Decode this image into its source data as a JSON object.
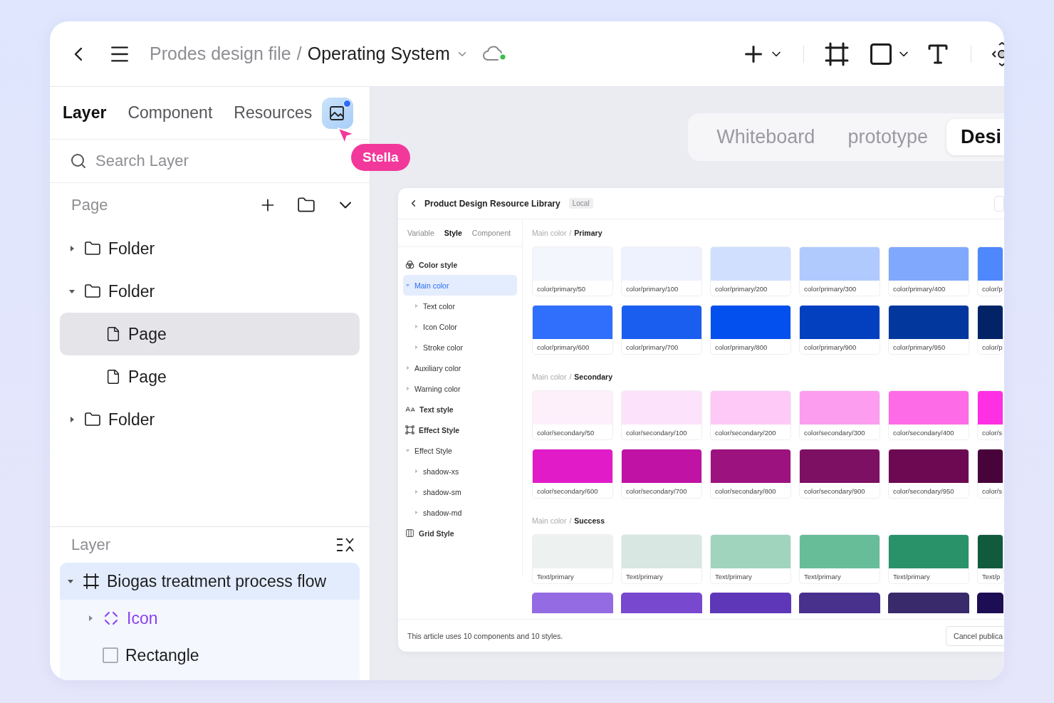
{
  "topbar": {
    "file": "Prodes design file",
    "separator": "/",
    "page": "Operating System"
  },
  "panel_tabs": [
    {
      "label": "Layer",
      "selected": true
    },
    {
      "label": "Component",
      "selected": false
    },
    {
      "label": "Resources",
      "selected": false
    }
  ],
  "resources_badge": {
    "unread": true
  },
  "cursor": {
    "name": "Stella"
  },
  "search": {
    "placeholder": "Search Layer"
  },
  "pages": {
    "title": "Page",
    "items": [
      {
        "kind": "folder",
        "label": "Folder",
        "expanded": false,
        "selected": false
      },
      {
        "kind": "folder",
        "label": "Folder",
        "expanded": true,
        "selected": false,
        "children": [
          {
            "kind": "page",
            "label": "Page",
            "selected": true
          },
          {
            "kind": "page",
            "label": "Page",
            "selected": false
          }
        ]
      },
      {
        "kind": "folder",
        "label": "Folder",
        "expanded": false,
        "selected": false
      }
    ]
  },
  "layers": {
    "title": "Layer",
    "items": [
      {
        "kind": "frame",
        "label": "Biogas treatment process flow",
        "expanded": true,
        "selected": true,
        "children": [
          {
            "kind": "component",
            "label": "Icon",
            "expanded": false,
            "selected": false
          },
          {
            "kind": "rectangle",
            "label": "Rectangle",
            "selected": false
          }
        ]
      }
    ]
  },
  "mode_tabs": [
    {
      "label": "Whiteboard",
      "selected": false
    },
    {
      "label": "prototype",
      "selected": false
    },
    {
      "label": "Desi",
      "selected": true
    }
  ],
  "library": {
    "title": "Product Design Resource Library",
    "tag": "Local",
    "tabs": [
      {
        "label": "Variable",
        "selected": false
      },
      {
        "label": "Style",
        "selected": true
      },
      {
        "label": "Component",
        "selected": false
      }
    ],
    "tree": [
      {
        "kind": "color",
        "label": "Color style",
        "children": [
          {
            "label": "Main color",
            "expanded": true,
            "selected": true,
            "children": [
              {
                "label": "Text color",
                "expanded": false,
                "selected": false
              },
              {
                "label": "Icon Color",
                "expanded": false,
                "selected": false
              },
              {
                "label": "Stroke color",
                "expanded": false,
                "selected": false
              }
            ]
          },
          {
            "label": "Auxiliary color",
            "expanded": false,
            "selected": false
          },
          {
            "label": "Warning color",
            "expanded": false,
            "selected": false
          }
        ]
      },
      {
        "kind": "text",
        "label": "Text style"
      },
      {
        "kind": "effect",
        "label": "Effect Style",
        "children": [
          {
            "label": "Effect Style",
            "expanded": true,
            "selected": false,
            "children": [
              {
                "label": "shadow-xs",
                "expanded": false,
                "selected": false
              },
              {
                "label": "shadow-sm",
                "expanded": false,
                "selected": false
              },
              {
                "label": "shadow-md",
                "expanded": false,
                "selected": false
              }
            ]
          }
        ]
      },
      {
        "kind": "grid",
        "label": "Grid Style"
      }
    ],
    "sections": [
      {
        "group": "Main color",
        "separator": "/",
        "name": "Primary",
        "rows": [
          [
            {
              "label": "color/primary/50",
              "color": "#f3f6fd"
            },
            {
              "label": "color/primary/100",
              "color": "#edf2fe"
            },
            {
              "label": "color/primary/200",
              "color": "#d0dffd"
            },
            {
              "label": "color/primary/300",
              "color": "#b0cafe"
            },
            {
              "label": "color/primary/400",
              "color": "#80a9fd"
            },
            {
              "label": "color/p",
              "color": "#4f87fc"
            }
          ],
          [
            {
              "label": "color/primary/600",
              "color": "#2f6ffb"
            },
            {
              "label": "color/primary/700",
              "color": "#1a5ef0"
            },
            {
              "label": "color/primary/800",
              "color": "#0450ee"
            },
            {
              "label": "color/primary/900",
              "color": "#0340c0"
            },
            {
              "label": "color/primary/950",
              "color": "#02389e"
            },
            {
              "label": "color/p",
              "color": "#022466"
            }
          ]
        ]
      },
      {
        "group": "Main color",
        "separator": "/",
        "name": "Secondary",
        "rows": [
          [
            {
              "label": "color/secondary/50",
              "color": "#fdf0fb"
            },
            {
              "label": "color/secondary/100",
              "color": "#fde2fb"
            },
            {
              "label": "color/secondary/200",
              "color": "#fec8f7"
            },
            {
              "label": "color/secondary/300",
              "color": "#fd9df0"
            },
            {
              "label": "color/secondary/400",
              "color": "#fe6be6"
            },
            {
              "label": "color/s",
              "color": "#ff2fe4"
            }
          ],
          [
            {
              "label": "color/secondary/600",
              "color": "#e01bc7"
            },
            {
              "label": "color/secondary/700",
              "color": "#c012a4"
            },
            {
              "label": "color/secondary/800",
              "color": "#9c127e"
            },
            {
              "label": "color/secondary/900",
              "color": "#7e1063"
            },
            {
              "label": "color/secondary/950",
              "color": "#6c0952"
            },
            {
              "label": "color/s",
              "color": "#48033a"
            }
          ]
        ]
      },
      {
        "group": "Main color",
        "separator": "/",
        "name": "Success",
        "rows": [
          [
            {
              "label": "Text/primary",
              "color": "#edf1f0"
            },
            {
              "label": "Text/primary",
              "color": "#d8e7e1"
            },
            {
              "label": "Text/primary",
              "color": "#a0d4bd"
            },
            {
              "label": "Text/primary",
              "color": "#67bd98"
            },
            {
              "label": "Text/primary",
              "color": "#2a9269"
            },
            {
              "label": "Text/p",
              "color": "#125a3e"
            }
          ],
          [
            {
              "color": "#946be2"
            },
            {
              "color": "#7848cf"
            },
            {
              "color": "#5e37b9"
            },
            {
              "color": "#48308d"
            },
            {
              "color": "#392a6b"
            },
            {
              "color": "#1c0d54"
            }
          ]
        ]
      }
    ],
    "footer": {
      "note": "This article uses 10 components and 10 styles.",
      "button": "Cancel publica"
    }
  }
}
